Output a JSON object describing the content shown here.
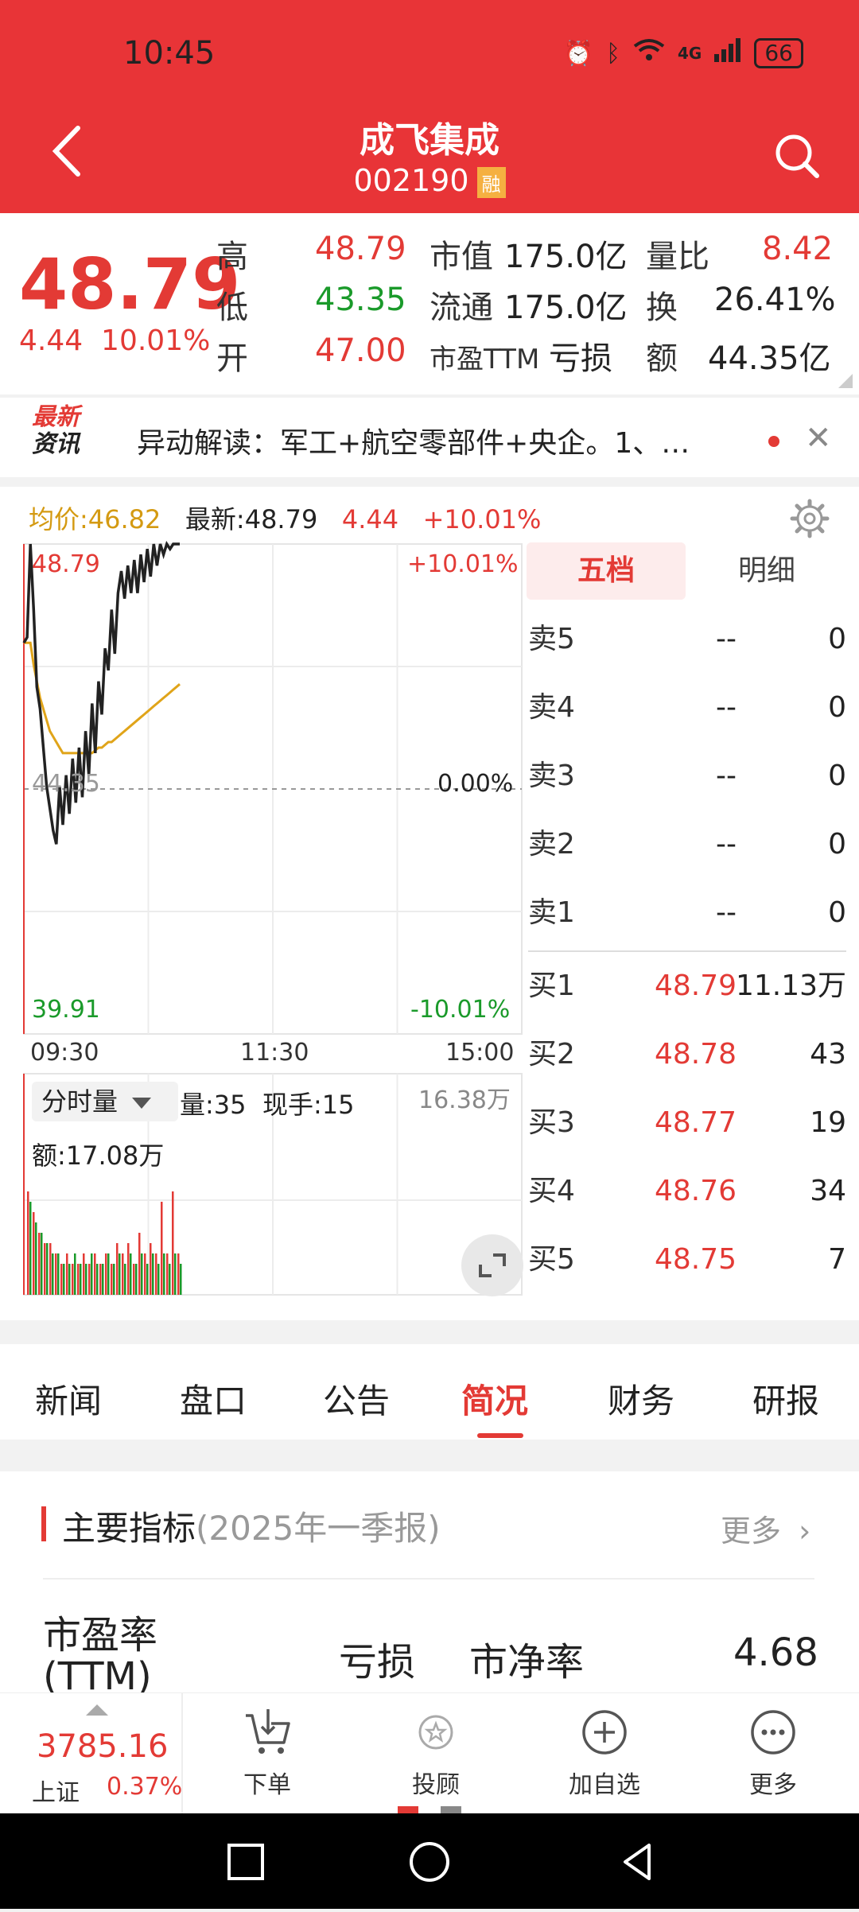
{
  "status": {
    "time": "10:45",
    "network": "4G",
    "battery": "66"
  },
  "header": {
    "title": "成飞集成",
    "code": "002190",
    "badge": "融"
  },
  "quote": {
    "price": "48.79",
    "change": "4.44",
    "change_pct": "10.01%",
    "high_label": "高",
    "high": "48.79",
    "low_label": "低",
    "low": "43.35",
    "open_label": "开",
    "open": "47.00",
    "mktcap_label": "市值",
    "mktcap": "175.0亿",
    "float_label": "流通",
    "float": "175.0亿",
    "pe_label": "市盈TTM",
    "pe": "亏损",
    "vol_ratio_label": "量比",
    "vol_ratio": "8.42",
    "turnover_label": "换",
    "turnover": "26.41%",
    "amount_label": "额",
    "amount": "44.35亿"
  },
  "news": {
    "logo_top": "最新",
    "logo_bottom": "资讯",
    "text": "异动解读：军工+航空零部件+央企。1、…"
  },
  "chart_head": {
    "avg_label": "均价:46.82",
    "latest_label": "最新:48.79",
    "change": "4.44",
    "change_pct": "+10.01%"
  },
  "chart_labels": {
    "top_price": "48.79",
    "mid_price": "44.35",
    "bottom_price": "39.91",
    "top_pct": "+10.01%",
    "mid_pct": "0.00%",
    "bottom_pct": "-10.01%",
    "time_start": "09:30",
    "time_mid": "11:30",
    "time_end": "15:00"
  },
  "volume_head": {
    "selector": "分时量",
    "vol": "量:35",
    "hand": "现手:15",
    "max": "16.38万",
    "amount": "额:17.08万"
  },
  "chart_data": {
    "type": "line",
    "x_range": [
      "09:30",
      "15:00"
    ],
    "ylim": [
      39.91,
      48.79
    ],
    "prev_close": 44.35,
    "x": [
      0,
      1,
      2,
      3,
      4,
      5,
      6,
      7,
      8,
      9,
      10,
      11,
      12,
      13,
      14,
      15,
      16,
      17,
      18,
      19,
      20,
      21,
      22,
      23,
      24,
      25,
      26,
      27,
      28,
      29,
      30,
      31,
      32,
      33,
      34,
      35,
      36,
      37,
      38,
      39,
      40,
      41,
      42,
      43,
      44,
      45,
      46,
      47,
      48
    ],
    "series": [
      {
        "name": "最新",
        "values": [
          47.0,
          47.1,
          48.79,
          47.6,
          46.2,
          45.8,
          45.1,
          44.4,
          44.0,
          43.6,
          43.35,
          44.4,
          43.7,
          44.6,
          43.9,
          44.9,
          44.1,
          45.1,
          44.2,
          45.4,
          44.6,
          45.9,
          45.0,
          46.3,
          45.7,
          46.9,
          46.5,
          47.6,
          46.8,
          47.9,
          48.3,
          47.8,
          48.4,
          47.9,
          48.5,
          47.9,
          48.6,
          48.1,
          48.7,
          48.2,
          48.79,
          48.4,
          48.79,
          48.6,
          48.79,
          48.7,
          48.79,
          48.79,
          48.79
        ]
      },
      {
        "name": "均价",
        "values": [
          47.0,
          47.0,
          47.0,
          46.6,
          46.3,
          46.0,
          45.8,
          45.6,
          45.4,
          45.3,
          45.2,
          45.1,
          45.0,
          45.0,
          45.0,
          45.0,
          45.0,
          45.0,
          45.0,
          45.0,
          45.0,
          45.0,
          45.05,
          45.1,
          45.1,
          45.15,
          45.2,
          45.2,
          45.25,
          45.3,
          45.35,
          45.4,
          45.45,
          45.5,
          45.55,
          45.6,
          45.65,
          45.7,
          45.75,
          45.8,
          45.85,
          45.9,
          45.95,
          46.0,
          46.05,
          46.1,
          46.15,
          46.2,
          46.25
        ]
      }
    ],
    "volume": {
      "red": [
        10,
        8,
        6,
        5,
        5,
        4,
        3,
        4,
        3,
        3,
        4,
        3,
        4,
        3,
        4,
        3,
        5,
        4,
        5,
        3,
        6,
        4,
        5,
        4,
        9,
        4,
        10,
        4
      ],
      "green": [
        9,
        7,
        6,
        5,
        4,
        4,
        3,
        3,
        4,
        3,
        3,
        4,
        3,
        3,
        4,
        3,
        4,
        3,
        4,
        3,
        4,
        3,
        4,
        3,
        4,
        3,
        4,
        3
      ]
    }
  },
  "order_book": {
    "tabs": [
      "五档",
      "明细"
    ],
    "sell": [
      {
        "label": "卖5",
        "price": "--",
        "vol": "0"
      },
      {
        "label": "卖4",
        "price": "--",
        "vol": "0"
      },
      {
        "label": "卖3",
        "price": "--",
        "vol": "0"
      },
      {
        "label": "卖2",
        "price": "--",
        "vol": "0"
      },
      {
        "label": "卖1",
        "price": "--",
        "vol": "0"
      }
    ],
    "buy": [
      {
        "label": "买1",
        "price": "48.79",
        "vol": "11.13万"
      },
      {
        "label": "买2",
        "price": "48.78",
        "vol": "43"
      },
      {
        "label": "买3",
        "price": "48.77",
        "vol": "19"
      },
      {
        "label": "买4",
        "price": "48.76",
        "vol": "34"
      },
      {
        "label": "买5",
        "price": "48.75",
        "vol": "7"
      }
    ]
  },
  "tabs": [
    "新闻",
    "盘口",
    "公告",
    "简况",
    "财务",
    "研报"
  ],
  "indicators": {
    "title": "主要指标",
    "period": "(2025年一季报)",
    "more": "更多",
    "pe_label": "市盈率(TTM)",
    "pe_value": "亏损",
    "pb_label": "市净率",
    "pb_value": "4.68"
  },
  "bottom": {
    "index_value": "3785.16",
    "index_name": "上证",
    "index_pct": "0.37%",
    "buttons": [
      "下单",
      "投顾",
      "加自选",
      "更多"
    ]
  },
  "colors": {
    "brand": "#e83437",
    "up": "#e33a35",
    "down": "#1a9a2a",
    "avg_line": "#e0a419"
  }
}
